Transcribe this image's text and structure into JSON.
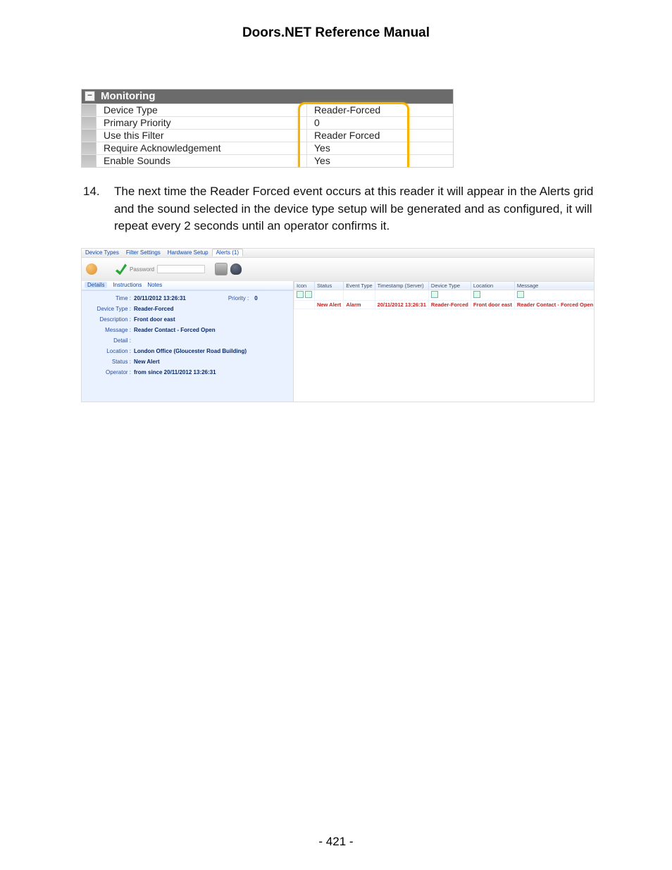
{
  "title": "Doors.NET Reference Manual",
  "monitoring": {
    "header": "Monitoring",
    "rows": [
      {
        "label": "Device Type",
        "value": "Reader-Forced"
      },
      {
        "label": "Primary Priority",
        "value": "0"
      },
      {
        "label": "Use this Filter",
        "value": "Reader Forced"
      },
      {
        "label": "Require Acknowledgement",
        "value": "Yes"
      },
      {
        "label": "Enable Sounds",
        "value": "Yes"
      }
    ]
  },
  "step": {
    "number": "14.",
    "text": "The next time the Reader Forced event occurs at this reader it will appear in the Alerts grid and the sound selected in the device type setup will be generated and as configured, it will repeat every 2 seconds until an operator confirms it."
  },
  "alerts_panel": {
    "top_tabs": [
      "Device Types",
      "Filter Settings",
      "Hardware Setup",
      "Alerts (1)"
    ],
    "toolbar": {
      "password_label": "Password",
      "btn_in_progress": "In Progress",
      "btn_confirm": "Confirm",
      "btn_play": "Play",
      "btn_sound": "Sound"
    },
    "subtabs": [
      "Details",
      "Instructions",
      "Notes"
    ],
    "details": [
      {
        "label": "Time :",
        "value": "20/11/2012 13:26:31",
        "extra_label": "Priority :",
        "extra_value": "0"
      },
      {
        "label": "Device Type :",
        "value": "Reader-Forced"
      },
      {
        "label": "Description :",
        "value": "Front door east"
      },
      {
        "label": "Message :",
        "value": "Reader Contact - Forced Open"
      },
      {
        "label": "Detail :",
        "value": ""
      },
      {
        "label": "Location :",
        "value": "London Office (Gloucester Road Building)"
      },
      {
        "label": "Status :",
        "value": "New Alert"
      },
      {
        "label": "Operator :",
        "value": "from  since 20/11/2012 13:26:31"
      }
    ],
    "grid": {
      "headers": [
        "Icon",
        "Status",
        "Event Type",
        "Timestamp (Server)",
        "Device Type",
        "Location",
        "Message"
      ],
      "row": {
        "status": "New Alert",
        "event_type": "Alarm",
        "timestamp": "20/11/2012 13:26:31",
        "device_type": "Reader-Forced",
        "location": "Front door east",
        "message": "Reader Contact - Forced Open"
      }
    }
  },
  "page_number": "- 421 -"
}
